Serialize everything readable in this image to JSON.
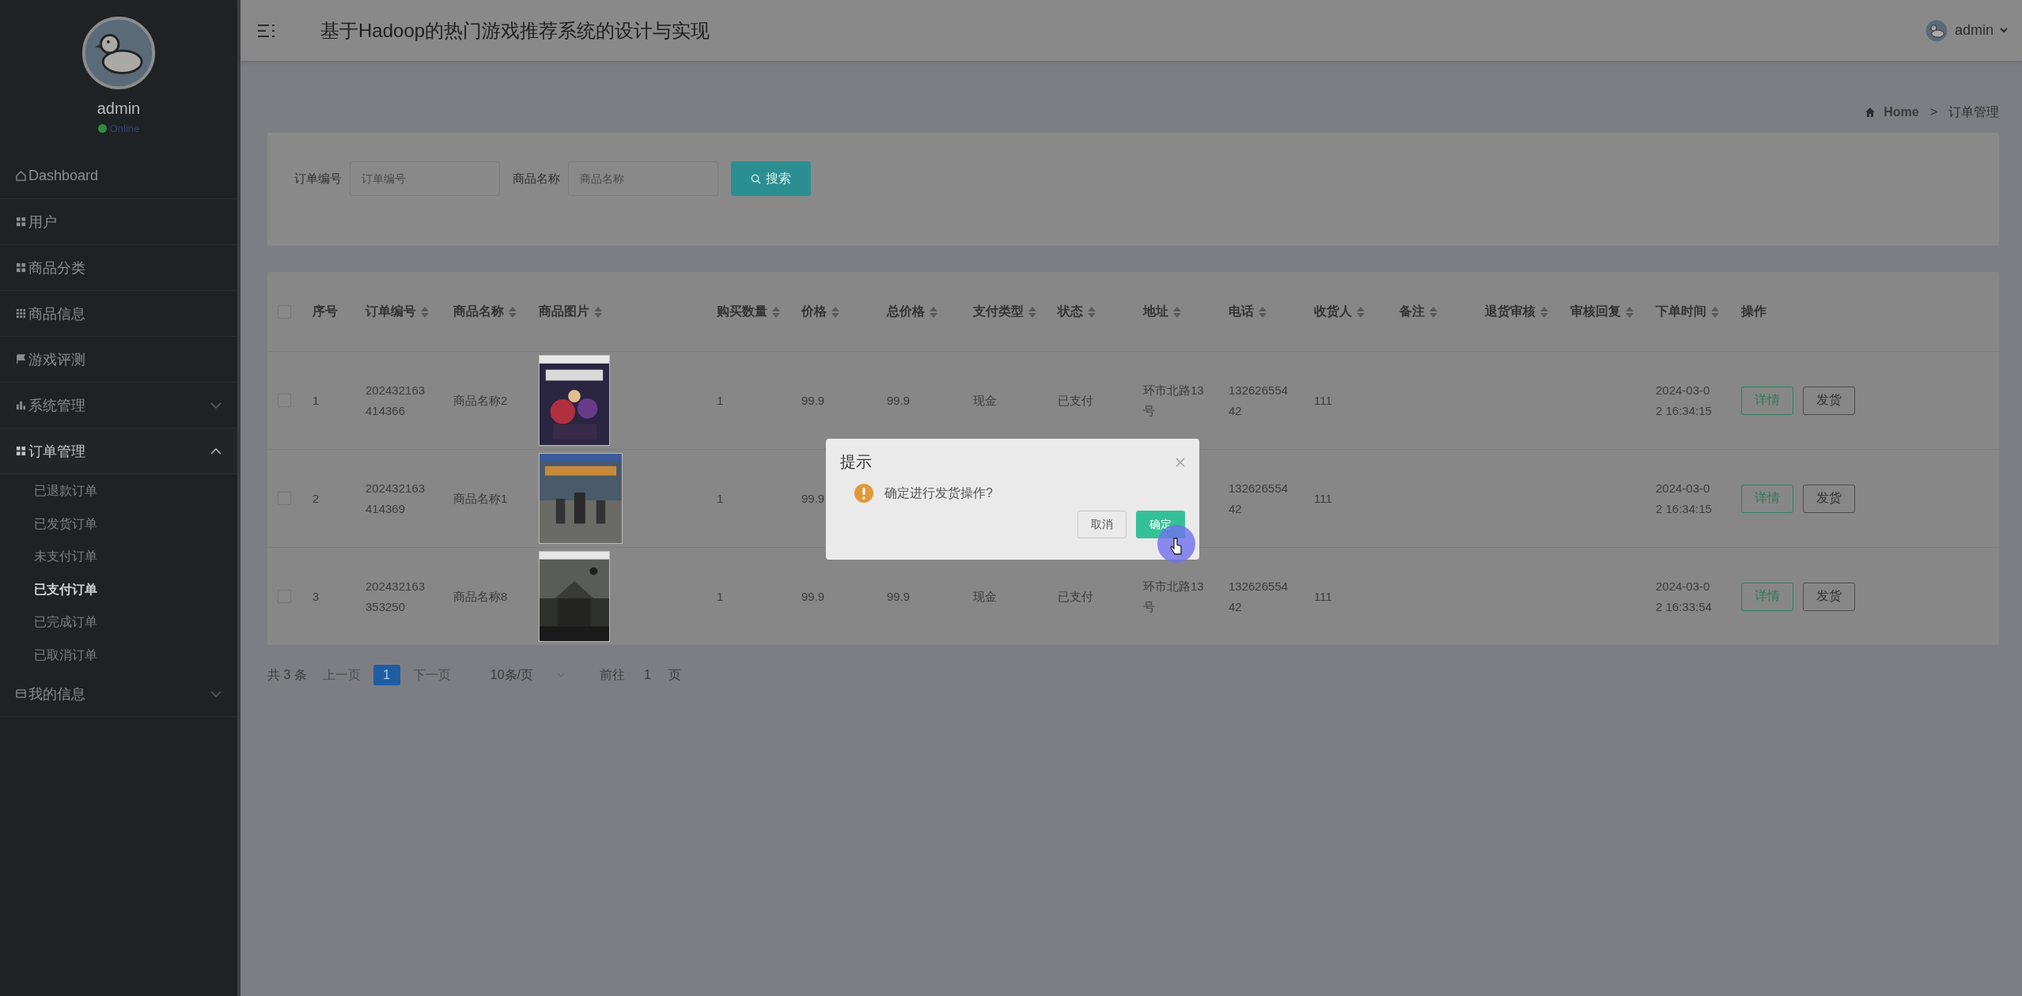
{
  "sidebar": {
    "user_name": "admin",
    "status": "Online",
    "items": [
      {
        "label": "Dashboard"
      },
      {
        "label": "用户"
      },
      {
        "label": "商品分类"
      },
      {
        "label": "商品信息"
      },
      {
        "label": "游戏评测"
      },
      {
        "label": "系统管理",
        "expanded": false
      },
      {
        "label": "订单管理",
        "expanded": true,
        "children": [
          {
            "label": "已退款订单",
            "selected": false
          },
          {
            "label": "已发货订单",
            "selected": false
          },
          {
            "label": "未支付订单",
            "selected": false
          },
          {
            "label": "已支付订单",
            "selected": true
          },
          {
            "label": "已完成订单",
            "selected": false
          },
          {
            "label": "已取消订单",
            "selected": false
          }
        ]
      },
      {
        "label": "我的信息",
        "expanded": false
      }
    ]
  },
  "header": {
    "title": "基于Hadoop的热门游戏推荐系统的设计与实现",
    "user": "admin"
  },
  "breadcrumb": {
    "items": [
      "Home",
      "订单管理"
    ],
    "separator": ">"
  },
  "search": {
    "fields": [
      {
        "label": "订单编号",
        "placeholder": "订单编号"
      },
      {
        "label": "商品名称",
        "placeholder": "商品名称"
      }
    ],
    "button": "搜索"
  },
  "table": {
    "all_checked": false,
    "columns": [
      {
        "label": "序号",
        "sortable": false
      },
      {
        "label": "订单编号",
        "sortable": true
      },
      {
        "label": "商品名称",
        "sortable": true
      },
      {
        "label": "商品图片",
        "sortable": true
      },
      {
        "label": "购买数量",
        "sortable": true
      },
      {
        "label": "价格",
        "sortable": true
      },
      {
        "label": "总价格",
        "sortable": true
      },
      {
        "label": "支付类型",
        "sortable": true
      },
      {
        "label": "状态",
        "sortable": true
      },
      {
        "label": "地址",
        "sortable": true
      },
      {
        "label": "电话",
        "sortable": true
      },
      {
        "label": "收货人",
        "sortable": true
      },
      {
        "label": "备注",
        "sortable": true
      },
      {
        "label": "退货审核",
        "sortable": true
      },
      {
        "label": "审核回复",
        "sortable": true
      },
      {
        "label": "下单时间",
        "sortable": true
      },
      {
        "label": "操作",
        "sortable": false
      }
    ],
    "rows": [
      {
        "checked": false,
        "index": "1",
        "order_no": "202432163414366",
        "product_name": "商品名称2",
        "image": {
          "kind": "picture"
        },
        "quantity": "1",
        "price": "99.9",
        "total": "99.9",
        "payment": "现金",
        "status": "已支付",
        "address": "环市北路13号",
        "phone": "13262655442",
        "receiver": "111",
        "time": "2024-03-02 16:34:15",
        "actions": [
          {
            "label": "详情",
            "kind": "primary"
          },
          {
            "label": "发货",
            "kind": "default"
          }
        ]
      },
      {
        "checked": false,
        "index": "2",
        "order_no": "202432163414369",
        "product_name": "商品名称1",
        "image": {
          "kind": "picture"
        },
        "quantity": "1",
        "price": "99.9",
        "phone": "13262655442",
        "receiver": "111",
        "time": "2024-03-02 16:34:15",
        "actions": [
          {
            "label": "详情",
            "kind": "primary"
          },
          {
            "label": "发货",
            "kind": "default"
          }
        ]
      },
      {
        "checked": false,
        "index": "3",
        "order_no": "202432163353250",
        "product_name": "商品名称8",
        "image": {
          "kind": "picture"
        },
        "quantity": "1",
        "price": "99.9",
        "total": "99.9",
        "payment": "现金",
        "status": "已支付",
        "address": "环市北路13号",
        "phone": "13262655442",
        "receiver": "111",
        "time": "2024-03-02 16:33:54",
        "actions": [
          {
            "label": "详情",
            "kind": "primary"
          },
          {
            "label": "发货",
            "kind": "default"
          }
        ]
      }
    ]
  },
  "pagination": {
    "total": "共 3 条",
    "prev": {
      "label": "上一页",
      "disabled": true
    },
    "pages": [
      {
        "label": "1",
        "selected": true
      }
    ],
    "next": {
      "label": "下一页",
      "disabled": true
    },
    "page_size": "10条/页",
    "goto_label": "前往",
    "goto_value": "1",
    "goto_suffix": "页"
  },
  "dialog": {
    "title": "提示",
    "message": "确定进行发货操作?",
    "buttons": [
      {
        "label": "取消",
        "kind": "default"
      },
      {
        "label": "确定",
        "kind": "primary"
      }
    ]
  }
}
